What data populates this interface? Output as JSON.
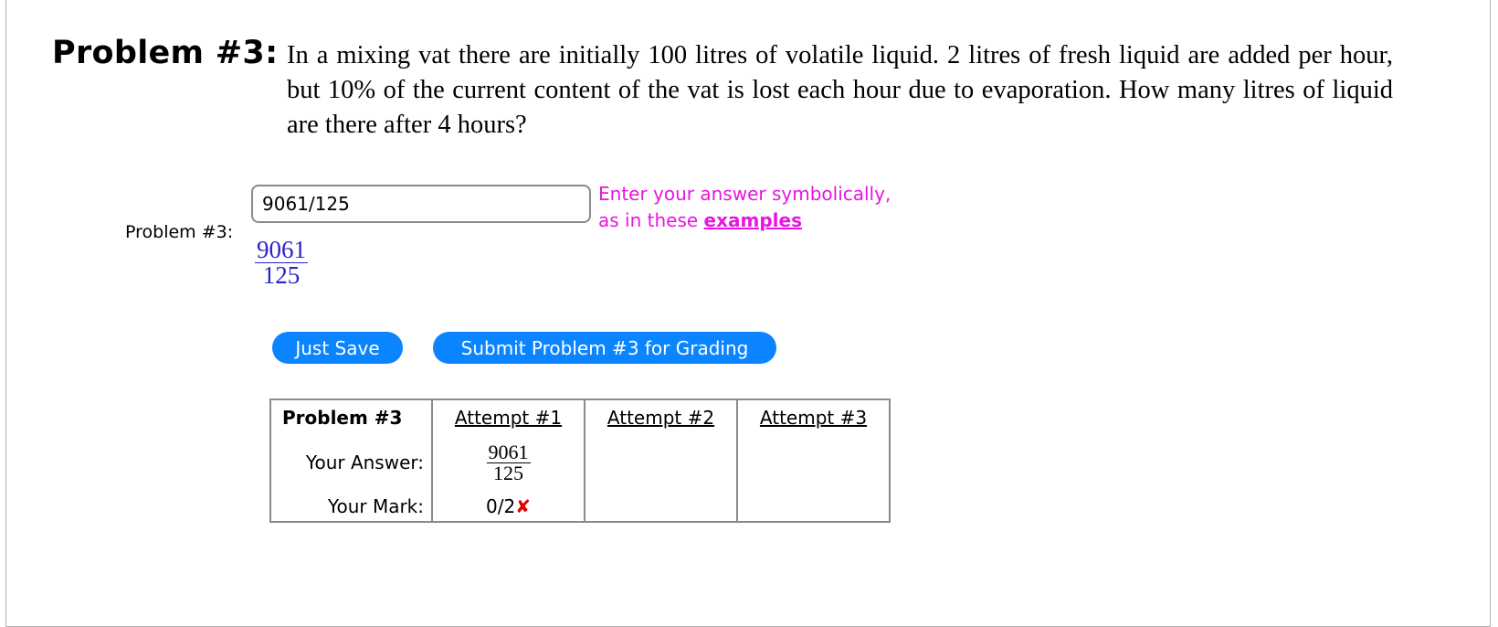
{
  "problem": {
    "title": "Problem #3:",
    "statement": "In a mixing vat there are initially 100 litres of volatile liquid. 2 litres of fresh liquid are added per hour, but 10% of the current content of the vat is lost each hour due to evaporation. How many litres of liquid are there after 4 hours?"
  },
  "answer_area": {
    "label": "Problem #3:",
    "input_value": "9061/125",
    "hint_line1": "Enter your answer symbolically,",
    "hint_line2_prefix": "as in these ",
    "hint_link": "examples",
    "preview": {
      "numerator": "9061",
      "denominator": "125"
    },
    "colors": {
      "hint": "#e815e0",
      "preview": "#2a22cc",
      "button": "#0a84ff"
    }
  },
  "buttons": {
    "save_label": "Just Save",
    "submit_label": "Submit Problem #3 for Grading"
  },
  "attempts_table": {
    "header": [
      "Problem #3",
      "Attempt #1",
      "Attempt #2",
      "Attempt #3"
    ],
    "answer_row_label": "Your Answer:",
    "mark_row_label": "Your Mark:",
    "attempt1_answer": {
      "numerator": "9061",
      "denominator": "125"
    },
    "attempt1_mark": "0/2",
    "attempt1_mark_icon": "cross-icon",
    "cross_glyph": "✘"
  }
}
